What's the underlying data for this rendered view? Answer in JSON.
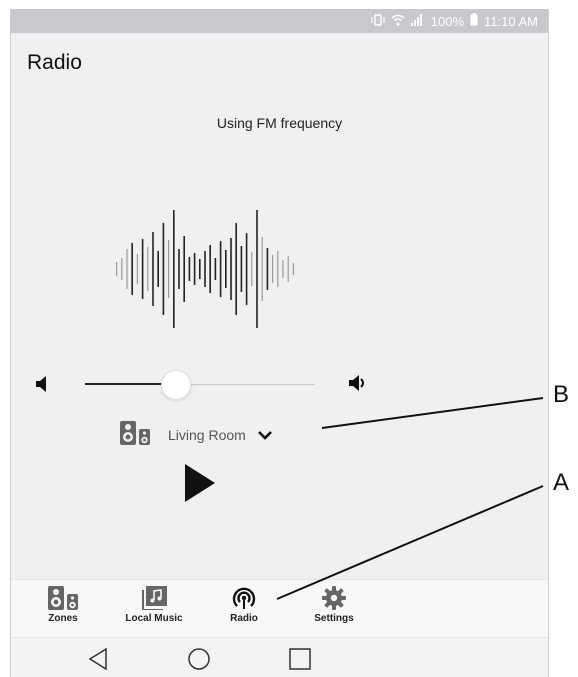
{
  "status_bar": {
    "battery": "100%",
    "time": "11:10 AM"
  },
  "page": {
    "title": "Radio",
    "source_text": "Using FM frequency"
  },
  "volume": {
    "level": 0.39
  },
  "zone_selector": {
    "label": "Living Room"
  },
  "tabs": [
    {
      "label": "Zones",
      "icon": "speakers-icon"
    },
    {
      "label": "Local Music",
      "icon": "music-library-icon"
    },
    {
      "label": "Radio",
      "icon": "radio-icon"
    },
    {
      "label": "Settings",
      "icon": "gear-icon"
    }
  ],
  "callouts": {
    "a": "A",
    "b": "B"
  },
  "colors": {
    "background": "#eff0f2",
    "status_bar": "#c8c9cc",
    "text": "#222222"
  }
}
